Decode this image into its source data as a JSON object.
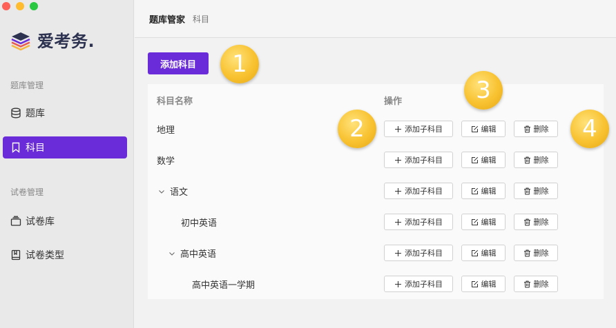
{
  "window": {
    "controls": [
      "#fe5f57",
      "#febc2e",
      "#28c840"
    ]
  },
  "sidebar": {
    "logo_text": "爱考务.",
    "groups": [
      {
        "title": "题库管理",
        "items": [
          {
            "label": "题库",
            "icon": "database-icon"
          },
          {
            "label": "科目",
            "icon": "bookmark-icon",
            "active": true
          }
        ]
      },
      {
        "title": "试卷管理",
        "items": [
          {
            "label": "试卷库",
            "icon": "tray-icon"
          },
          {
            "label": "试卷类型",
            "icon": "book-icon"
          }
        ]
      }
    ]
  },
  "header": {
    "title": "题库管家",
    "breadcrumb": "科目"
  },
  "main": {
    "add_button": "添加科目",
    "table": {
      "columns": [
        "科目名称",
        "操作"
      ],
      "actions": {
        "add_child": "添加子科目",
        "edit": "编辑",
        "delete": "删除"
      },
      "rows": [
        {
          "name": "地理",
          "level": 0,
          "expanded": null
        },
        {
          "name": "数学",
          "level": 0,
          "expanded": null
        },
        {
          "name": "语文",
          "level": 0,
          "expanded": true
        },
        {
          "name": "初中英语",
          "level": 1,
          "expanded": null
        },
        {
          "name": "高中英语",
          "level": 1,
          "expanded": true
        },
        {
          "name": "高中英语一学期",
          "level": 2,
          "expanded": null
        }
      ]
    }
  },
  "callouts": [
    "1",
    "2",
    "3",
    "4"
  ],
  "colors": {
    "accent": "#6a2bd9",
    "callout": "#f8c230"
  }
}
